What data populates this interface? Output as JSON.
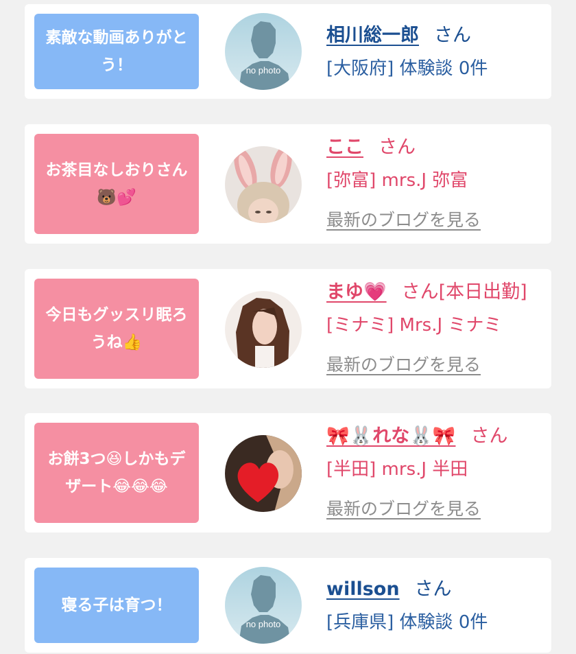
{
  "reviews": [
    {
      "message": "素敵な動画ありがとう！",
      "name": "相川総一郎",
      "honorific": "さん",
      "subtitle": "[大阪府] 体験談 0件",
      "avatar": "no-photo-avatar",
      "avatar_text": "no photo",
      "color": "#86b8f6"
    },
    {
      "message": "お茶目なしおりさん🐻💕",
      "name": "ここ",
      "honorific": "さん",
      "subtitle": "[弥富] mrs.J 弥富",
      "blog_link": "最新のブログを見る",
      "avatar": "bunny-ears-photo",
      "color": "#f58fa2"
    },
    {
      "message": "今日もグッスリ眠ろうね👍",
      "name": "まゆ💗",
      "honorific": "さん[本日出勤]",
      "subtitle": "[ミナミ] Mrs.J ミナミ",
      "blog_link": "最新のブログを見る",
      "avatar": "long-hair-photo",
      "color": "#f58fa2"
    },
    {
      "message": "お餅3つ😆しかもデザート😂😂😂",
      "name": "🎀🐰れな🐰🎀",
      "honorific": "さん",
      "subtitle": "[半田] mrs.J 半田",
      "blog_link": "最新のブログを見る",
      "avatar": "heart-covered-photo",
      "color": "#f58fa2"
    },
    {
      "message": "寝る子は育つ！",
      "name": "willson",
      "honorific": "さん",
      "subtitle": "[兵庫県] 体験談 0件",
      "avatar": "no-photo-avatar",
      "avatar_text": "no photo",
      "color": "#86b8f6"
    }
  ]
}
